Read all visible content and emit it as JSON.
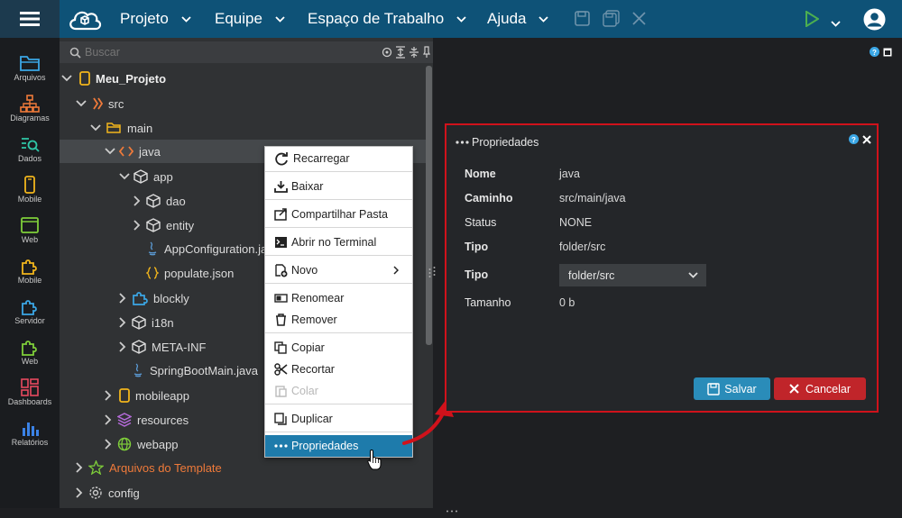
{
  "topbar": {
    "menus": [
      "Projeto",
      "Equipe",
      "Espaço de Trabalho",
      "Ajuda"
    ]
  },
  "sidebar": {
    "items": [
      "Arquivos",
      "Diagramas",
      "Dados",
      "Mobile",
      "Web",
      "Mobile",
      "Servidor",
      "Web",
      "Dashboards",
      "Relatórios"
    ]
  },
  "search": {
    "placeholder": "Buscar"
  },
  "tree": {
    "project": "Meu_Projeto",
    "src": "src",
    "main": "main",
    "java": "java",
    "app": "app",
    "dao": "dao",
    "entity": "entity",
    "appconfig": "AppConfiguration.java",
    "populate": "populate.json",
    "blockly": "blockly",
    "i18n": "i18n",
    "metainf": "META-INF",
    "springboot": "SpringBootMain.java",
    "mobileapp": "mobileapp",
    "resources": "resources",
    "webapp": "webapp",
    "template": "Arquivos do Template",
    "config": "config"
  },
  "context_menu": {
    "reload": "Recarregar",
    "download": "Baixar",
    "share": "Compartilhar Pasta",
    "terminal": "Abrir no Terminal",
    "new": "Novo",
    "rename": "Renomear",
    "remove": "Remover",
    "copy": "Copiar",
    "cut": "Recortar",
    "paste": "Colar",
    "duplicate": "Duplicar",
    "properties": "Propriedades"
  },
  "dialog": {
    "title": "Propriedades",
    "name_label": "Nome",
    "name_value": "java",
    "path_label": "Caminho",
    "path_value": "src/main/java",
    "status_label": "Status",
    "status_value": "NONE",
    "type_label": "Tipo",
    "type_value": "folder/src",
    "type2_label": "Tipo",
    "type2_select": "folder/src",
    "size_label": "Tamanho",
    "size_value": "0 b",
    "save": "Salvar",
    "cancel": "Cancelar"
  },
  "colors": {
    "topbar": "#0e5277",
    "accent": "#1e7bab",
    "danger": "#c0252a",
    "run": "#4caf50"
  }
}
